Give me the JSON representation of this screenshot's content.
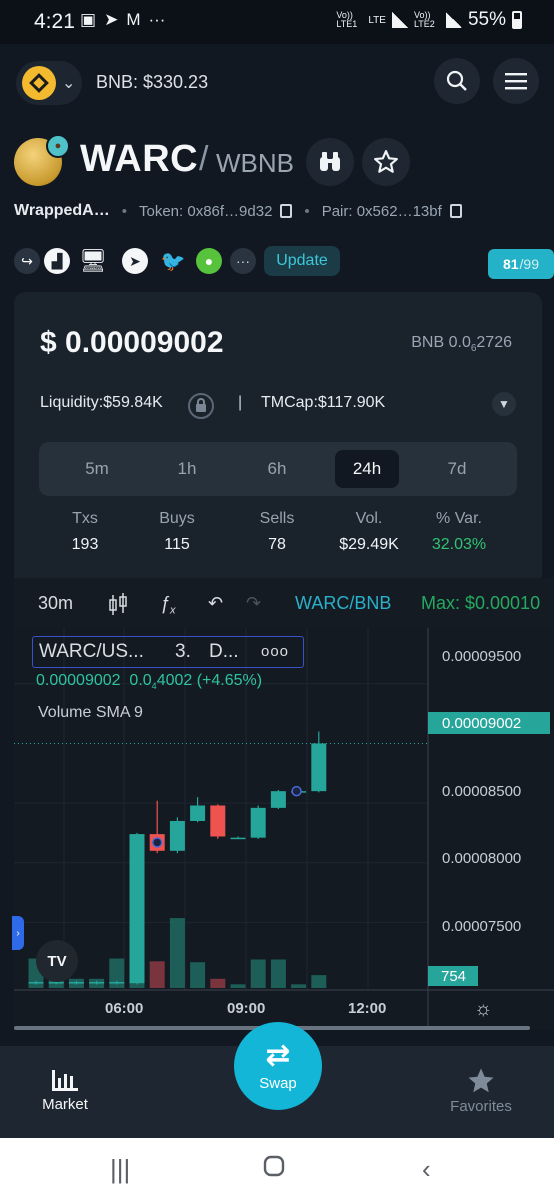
{
  "status_bar": {
    "time": "4:21",
    "left_icons": [
      "image-icon",
      "telegram-icon",
      "gmail-icon",
      "more-icon"
    ],
    "sim1": "Vo)) LTE1",
    "lte": "LTE",
    "sim2": "Vo)) LTE2",
    "battery": "55%"
  },
  "top_bar": {
    "chain_icon": "bnb-logo-icon",
    "bnb_price": "BNB: $330.23"
  },
  "token": {
    "name": "WARC",
    "slash": "/",
    "pair": "WBNB",
    "full_name": "WrappedA…",
    "token_addr": "Token: 0x86f…9d32",
    "pair_addr": "Pair: 0x562…13bf",
    "update_label": "Update",
    "score": "81",
    "score_max": "/99"
  },
  "price_card": {
    "price_usd": "$ 0.00009002",
    "price_bnb_prefix": "BNB 0.0",
    "price_bnb_sub": "6",
    "price_bnb_rest": "2726",
    "liquidity_label": "Liquidity:",
    "liquidity_value": "$59.84K",
    "separator": "|",
    "tmcap_label": "TMCap:",
    "tmcap_value": "$117.90K",
    "timeframes": [
      "5m",
      "1h",
      "6h",
      "24h",
      "7d"
    ],
    "active_timeframe": "24h",
    "stats": [
      {
        "label": "Txs",
        "value": "193"
      },
      {
        "label": "Buys",
        "value": "115"
      },
      {
        "label": "Sells",
        "value": "78"
      },
      {
        "label": "Vol.",
        "value": "$29.49K"
      },
      {
        "label": "% Var.",
        "value": "32.03%"
      }
    ]
  },
  "chart": {
    "interval": "30m",
    "pair_label": "WARC/BNB",
    "max_label": "Max: $0.00010",
    "legend_symbol": "WARC/US...",
    "legend_res": "3.",
    "legend_ex": "D...",
    "legend_more": "ooo",
    "legend_value": "0.00009002",
    "legend_change_prefix": "0.0",
    "legend_change_sub": "4",
    "legend_change_rest": "4002 (+4.65%)",
    "legend_volume": "Volume SMA 9",
    "y_labels": [
      "0.00009500",
      "0.00008500",
      "0.00008000",
      "0.00007500"
    ],
    "last_price_tag": "0.00009002",
    "volume_tag": "754",
    "x_labels": [
      "06:00",
      "09:00",
      "12:00"
    ],
    "tv_logo": "TV",
    "colors": {
      "up": "#26a69a",
      "down": "#ef5350",
      "accent": "#13b6d6"
    }
  },
  "chart_data": {
    "type": "candlestick",
    "ylim": [
      6.95e-05,
      9.8e-05
    ],
    "y_ticks": [
      9.5e-05,
      8.5e-05,
      8e-05,
      7.5e-05
    ],
    "candles": [
      {
        "o": 6.99e-05,
        "h": 7.01e-05,
        "l": 6.98e-05,
        "c": 7e-05,
        "v": 0.32
      },
      {
        "o": 6.99e-05,
        "h": 7.01e-05,
        "l": 6.98e-05,
        "c": 7e-05,
        "v": 0.1
      },
      {
        "o": 6.99e-05,
        "h": 7.01e-05,
        "l": 6.98e-05,
        "c": 7e-05,
        "v": 0.1
      },
      {
        "o": 6.99e-05,
        "h": 7.01e-05,
        "l": 6.98e-05,
        "c": 7e-05,
        "v": 0.1
      },
      {
        "o": 6.99e-05,
        "h": 7.01e-05,
        "l": 6.98e-05,
        "c": 7e-05,
        "v": 0.32
      },
      {
        "o": 6.99e-05,
        "h": 8.25e-05,
        "l": 6.98e-05,
        "c": 8.24e-05,
        "v": 1.0
      },
      {
        "o": 8.24e-05,
        "h": 8.52e-05,
        "l": 8.08e-05,
        "c": 8.1e-05,
        "v": 0.29
      },
      {
        "o": 8.1e-05,
        "h": 8.38e-05,
        "l": 8.08e-05,
        "c": 8.35e-05,
        "v": 0.76
      },
      {
        "o": 8.35e-05,
        "h": 8.55e-05,
        "l": 8.34e-05,
        "c": 8.48e-05,
        "v": 0.28
      },
      {
        "o": 8.48e-05,
        "h": 8.49e-05,
        "l": 8.2e-05,
        "c": 8.22e-05,
        "v": 0.1
      },
      {
        "o": 8.21e-05,
        "h": 8.22e-05,
        "l": 8.2e-05,
        "c": 8.21e-05,
        "v": 0.04
      },
      {
        "o": 8.21e-05,
        "h": 8.48e-05,
        "l": 8.2e-05,
        "c": 8.46e-05,
        "v": 0.31
      },
      {
        "o": 8.46e-05,
        "h": 8.61e-05,
        "l": 8.45e-05,
        "c": 8.6e-05,
        "v": 0.31
      },
      {
        "o": 8.6e-05,
        "h": 8.61e-05,
        "l": 8.59e-05,
        "c": 8.6e-05,
        "v": 0.04
      },
      {
        "o": 8.6e-05,
        "h": 9.1e-05,
        "l": 8.59e-05,
        "c": 9e-05,
        "v": 0.14
      }
    ],
    "markers": [
      6,
      13
    ]
  }
}
